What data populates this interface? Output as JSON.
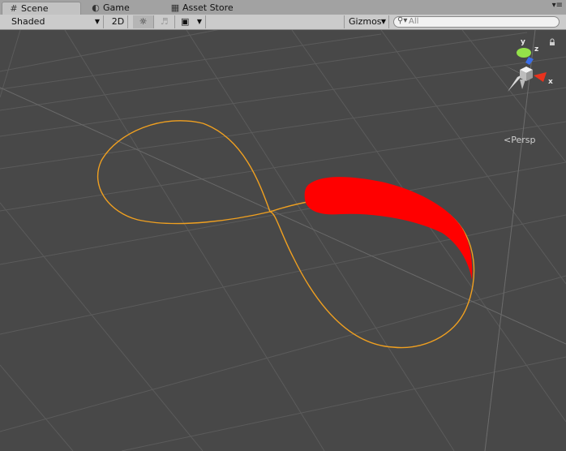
{
  "tabs": [
    {
      "label": "Scene",
      "icon": "grid-icon",
      "active": true
    },
    {
      "label": "Game",
      "icon": "pacman-icon",
      "active": false
    },
    {
      "label": "Asset Store",
      "icon": "bag-icon",
      "active": false
    }
  ],
  "toolbar": {
    "shading_mode": "Shaded",
    "mode_2d": "2D",
    "gizmos": "Gizmos",
    "search_placeholder": "All"
  },
  "gizmo": {
    "axis_y": "y",
    "axis_z": "z",
    "axis_x": "x",
    "projection": "Persp",
    "colors": {
      "x": "#e8321d",
      "y": "#94e24a",
      "z": "#3a6ee8",
      "neutral": "#e0e0e0"
    }
  },
  "scene": {
    "background": "#484848",
    "path_color": "#f0a020",
    "trail_color": "#ff0000"
  }
}
